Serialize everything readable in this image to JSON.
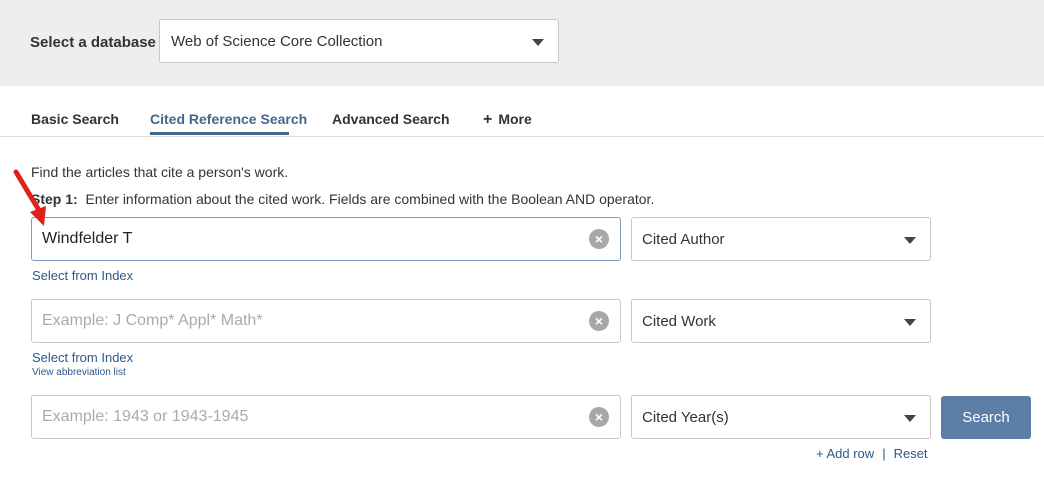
{
  "database": {
    "label": "Select a database",
    "selected": "Web of Science Core Collection"
  },
  "tabs": [
    {
      "label": "Basic Search"
    },
    {
      "label": "Cited Reference Search"
    },
    {
      "label": "Advanced Search"
    },
    {
      "label": "More"
    }
  ],
  "intro": "Find the articles that cite a person's work.",
  "step": {
    "label": "Step 1:",
    "text": "Enter information about the cited work. Fields are combined with the Boolean AND operator."
  },
  "rows": [
    {
      "value": "Windfelder T",
      "placeholder": "",
      "field_type": "Cited Author"
    },
    {
      "value": "",
      "placeholder": "Example: J Comp* Appl* Math*",
      "field_type": "Cited Work"
    },
    {
      "value": "",
      "placeholder": "Example: 1943 or 1943-1945",
      "field_type": "Cited Year(s)"
    }
  ],
  "links": {
    "select_index_1": "Select from Index",
    "select_index_2": "Select from Index",
    "abbreviation_list": "View abbreviation list"
  },
  "search_button": "Search",
  "row_actions": {
    "add_row": "+ Add row",
    "separator": "|",
    "reset": "Reset"
  },
  "colors": {
    "accent": "#44678c",
    "link": "#2b5a8a",
    "button": "#5a7ea6",
    "annotation_arrow": "#e0201b"
  },
  "icons": {
    "clear": "clear-circle-icon",
    "dropdown": "chevron-down-icon",
    "more": "plus-icon",
    "annotation": "red-arrow-icon"
  }
}
